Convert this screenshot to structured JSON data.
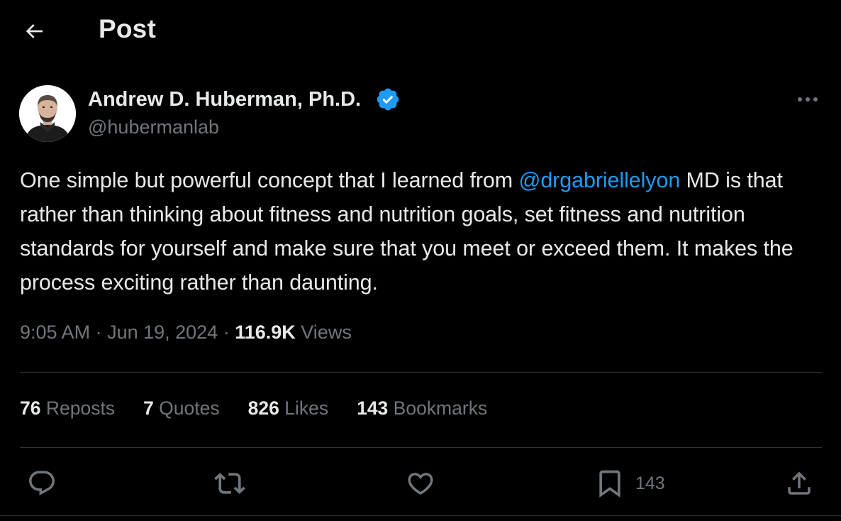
{
  "header": {
    "back_icon": "arrow-left-icon",
    "title": "Post"
  },
  "author": {
    "name": "Andrew D. Huberman, Ph.D.",
    "handle": "@hubermanlab",
    "verified_icon": "verified-badge-icon",
    "verified_color": "#1d9bf0"
  },
  "tweet": {
    "text_before": "One simple but powerful concept that I learned from ",
    "mention": "@drgabriellelyon",
    "text_after": " MD is that rather than thinking about fitness and nutrition goals, set fitness and nutrition standards for yourself and make sure that you meet or exceed them. It makes the process exciting rather than daunting."
  },
  "meta": {
    "time": "9:05 AM",
    "sep1": " · ",
    "date": "Jun 19, 2024",
    "sep2": " · ",
    "views_count": "116.9K",
    "views_label": " Views"
  },
  "stats": {
    "reposts_count": "76",
    "reposts_label": " Reposts",
    "quotes_count": "7",
    "quotes_label": " Quotes",
    "likes_count": "826",
    "likes_label": " Likes",
    "bookmarks_count": "143",
    "bookmarks_label": " Bookmarks"
  },
  "actions": {
    "reply_icon": "reply-icon",
    "repost_icon": "repost-icon",
    "like_icon": "heart-icon",
    "bookmark_icon": "bookmark-icon",
    "bookmark_count": "143",
    "share_icon": "share-icon"
  },
  "colors": {
    "background": "#000000",
    "text": "#e7e9ea",
    "secondary": "#71767b",
    "accent": "#1d9bf0",
    "divider": "#2f3336"
  }
}
